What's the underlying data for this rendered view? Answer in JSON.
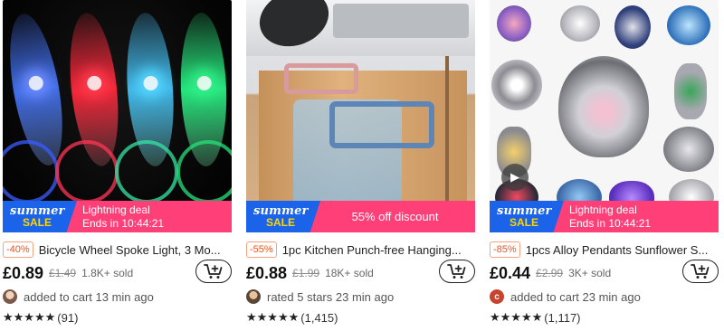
{
  "products": [
    {
      "banner": {
        "summer": "summer",
        "sale": "SALE",
        "line1": "Lightning deal",
        "line2": "Ends in 10:44:21"
      },
      "discount": "-40%",
      "title": "Bicycle Wheel Spoke Light, 3 Mo...",
      "price": "£0.89",
      "old_price": "£1.49",
      "sold": "1.8K+ sold",
      "activity": "added to cart 13 min ago",
      "stars": "★★★★★",
      "review_count": "(91)",
      "icons": {
        "cart": "add-to-cart-icon",
        "avatar": "user-avatar"
      }
    },
    {
      "banner": {
        "summer": "summer",
        "sale": "SALE",
        "line1": "55% off discount"
      },
      "discount": "-55%",
      "title": "1pc Kitchen Punch-free Hanging...",
      "price": "£0.88",
      "old_price": "£1.99",
      "sold": "18K+ sold",
      "activity": "rated 5 stars 23 min ago",
      "stars": "★★★★★",
      "review_count": "(1,415)",
      "icons": {
        "cart": "add-to-cart-icon",
        "avatar": "user-avatar"
      }
    },
    {
      "banner": {
        "summer": "summer",
        "sale": "SALE",
        "line1": "Lightning deal",
        "line2": "Ends in 10:44:21"
      },
      "discount": "-85%",
      "title": "1pcs Alloy Pendants Sunflower S...",
      "price": "£0.44",
      "old_price": "£2.99",
      "sold": "3K+ sold",
      "activity": "added to cart 23 min ago",
      "avatar_letter": "c",
      "stars": "★★★★★",
      "review_count": "(1,117)",
      "icons": {
        "cart": "add-to-cart-icon",
        "avatar": "user-avatar",
        "play": "play-icon"
      }
    }
  ],
  "colors": {
    "banner_pink": "#ff3f78",
    "summer_blue": "#1b63e8",
    "sale_yellow": "#ffd400",
    "discount_orange": "#e8551e"
  }
}
